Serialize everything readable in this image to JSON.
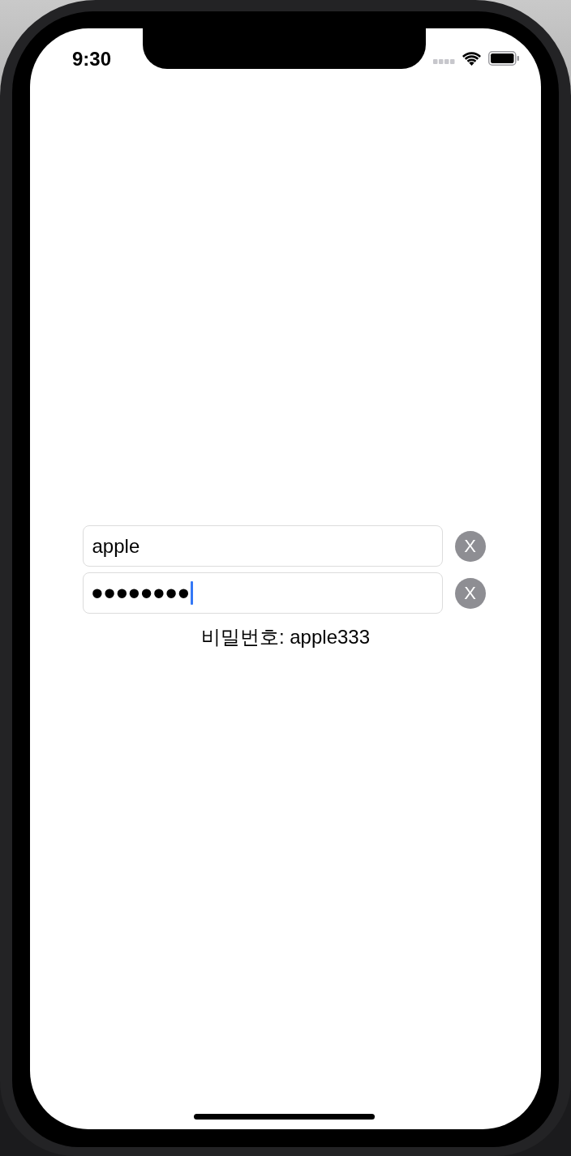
{
  "status_bar": {
    "time": "9:30"
  },
  "fields": [
    {
      "kind": "text",
      "value": "apple",
      "focused": false,
      "clear_button": "X"
    },
    {
      "kind": "password",
      "value": "••••••••",
      "focused": true,
      "clear_button": "X"
    }
  ],
  "password_label": "비밀번호: apple333"
}
